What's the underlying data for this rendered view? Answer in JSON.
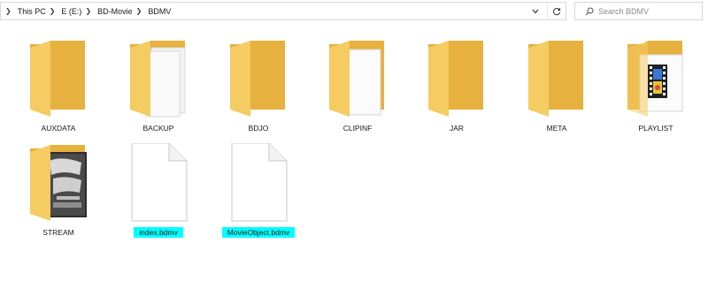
{
  "breadcrumb": [
    "This PC",
    "E (E:)",
    "BD-Movie",
    "BDMV"
  ],
  "search": {
    "placeholder": "Search BDMV"
  },
  "items": [
    {
      "name": "AUXDATA",
      "kind": "folder",
      "selected": false
    },
    {
      "name": "BACKUP",
      "kind": "folder-documents",
      "selected": false
    },
    {
      "name": "BDJO",
      "kind": "folder",
      "selected": false
    },
    {
      "name": "CLIPINF",
      "kind": "folder-document",
      "selected": false
    },
    {
      "name": "JAR",
      "kind": "folder",
      "selected": false
    },
    {
      "name": "META",
      "kind": "folder",
      "selected": false
    },
    {
      "name": "PLAYLIST",
      "kind": "folder-video",
      "selected": false
    },
    {
      "name": "STREAM",
      "kind": "folder-poster",
      "selected": false
    },
    {
      "name": "index.bdmv",
      "kind": "file",
      "selected": true
    },
    {
      "name": "MovieObject.bdmv",
      "kind": "file",
      "selected": true
    }
  ],
  "colors": {
    "folder": "#f4cc62",
    "folder_dark": "#e6b13e",
    "selection": "#00ffff"
  },
  "icons": [
    "chevron-right-icon",
    "chevron-down-icon",
    "refresh-icon",
    "search-icon",
    "folder-icon",
    "file-icon"
  ]
}
